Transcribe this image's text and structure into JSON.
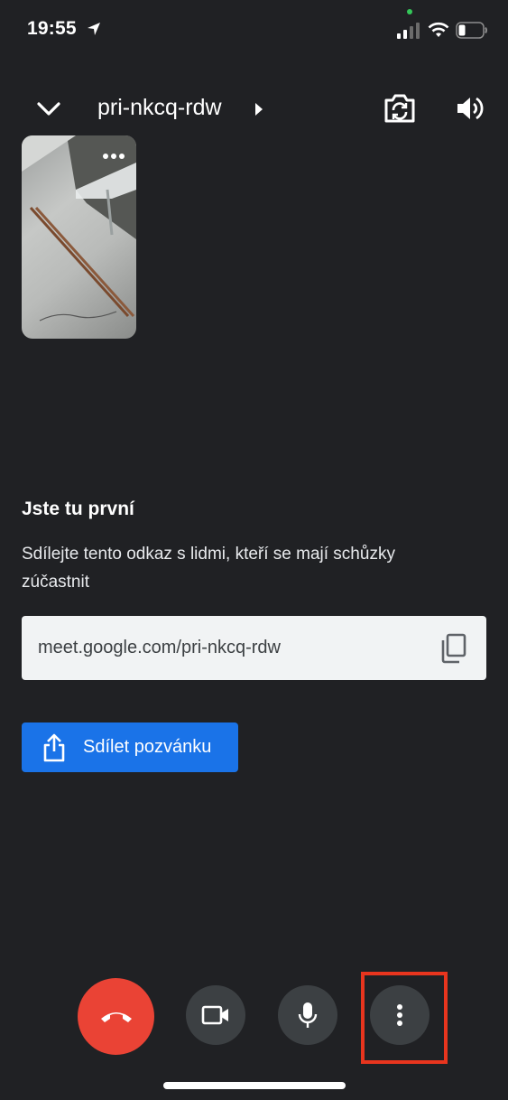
{
  "status_bar": {
    "time": "19:55",
    "icons": [
      "location-arrow-icon",
      "signal-icon",
      "wifi-icon",
      "battery-icon"
    ]
  },
  "top_bar": {
    "meeting_code": "pri-nkcq-rdw",
    "icons": [
      "chevron-down-icon",
      "caret-right-icon",
      "switch-camera-icon",
      "speaker-icon"
    ]
  },
  "info": {
    "heading": "Jste tu první",
    "hint": "Sdílejte tento odkaz s lidmi, kteří se mají schůzky zúčastnit",
    "link": "meet.google.com/pri-nkcq-rdw",
    "share_label": "Sdílet pozvánku"
  },
  "controls": {
    "icons": [
      "hang-up-icon",
      "video-camera-icon",
      "microphone-icon",
      "more-vert-icon"
    ]
  },
  "colors": {
    "background": "#202124",
    "end_call": "#ea4335",
    "share_button": "#1a73e8",
    "control_button": "#3c4043",
    "highlight": "#e8351e"
  }
}
